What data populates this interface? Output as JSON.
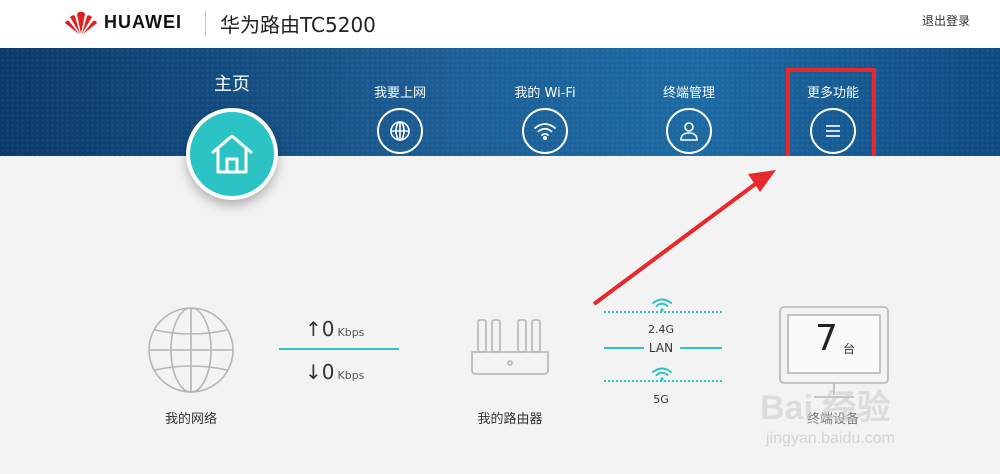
{
  "header": {
    "brand": "HUAWEI",
    "product": "华为路由TC5200",
    "logout": "退出登录"
  },
  "nav": {
    "home": "主页",
    "items": [
      {
        "label": "我要上网",
        "icon": "globe-icon"
      },
      {
        "label": "我的 Wi-Fi",
        "icon": "wifi-icon"
      },
      {
        "label": "终端管理",
        "icon": "user-icon"
      },
      {
        "label": "更多功能",
        "icon": "menu-icon"
      }
    ]
  },
  "status": {
    "network_label": "我的网络",
    "upload_value": "0",
    "upload_unit": "Kbps",
    "download_value": "0",
    "download_unit": "Kbps",
    "router_label": "我的路由器",
    "band_24": "2.4G",
    "band_lan": "LAN",
    "band_5": "5G",
    "device_count": "7",
    "device_unit": "台",
    "device_label": "终端设备"
  },
  "watermark": {
    "text": "Bai 经验",
    "url": "jingyan.baidu.com"
  },
  "colors": {
    "accent": "#2cc3c5",
    "highlight": "#e8282b",
    "band": "#1c5e95"
  }
}
